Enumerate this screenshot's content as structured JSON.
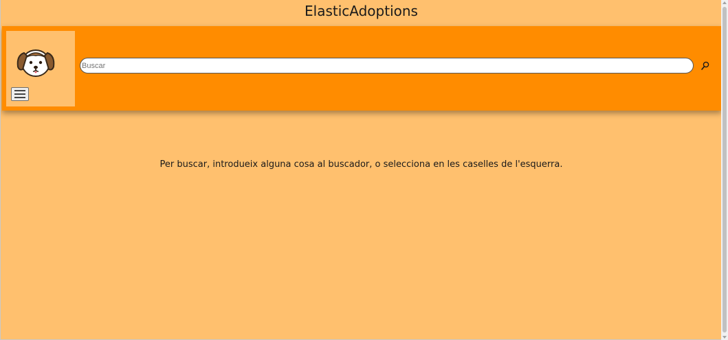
{
  "app": {
    "title": "ElasticAdoptions"
  },
  "header": {
    "logo_icon": "puppy-icon",
    "menu_icon": "hamburger-icon",
    "search": {
      "placeholder": "Buscar",
      "value": ""
    },
    "search_icon": "magnifier-icon"
  },
  "main": {
    "info": "Per buscar, introdueix alguna cosa al buscador, o selecciona en les caselles de l'esquerra."
  },
  "colors": {
    "background": "#ffc06e",
    "header": "#ff8c00",
    "logo_box": "#ffc06e"
  }
}
